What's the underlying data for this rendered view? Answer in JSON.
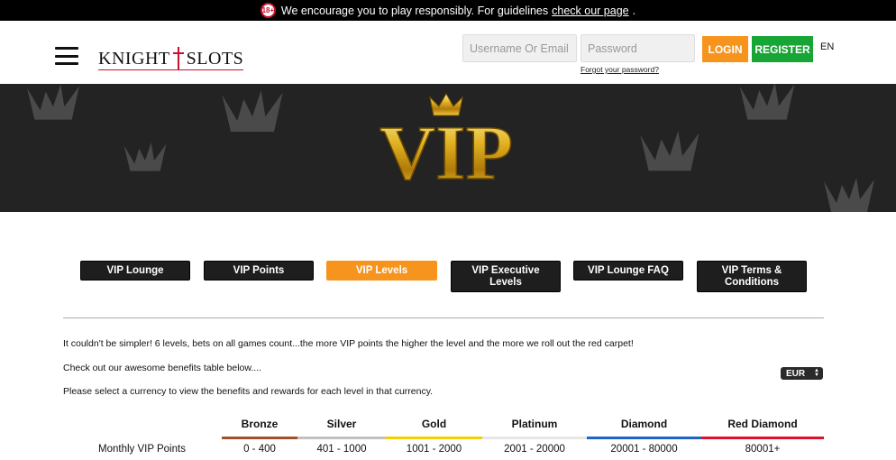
{
  "banner": {
    "badge": "18+",
    "text": "We encourage you to play responsibly. For guidelines",
    "link": "check our page",
    "suffix": "."
  },
  "header": {
    "logo_left": "KNIGHT",
    "logo_right": "SLOTS",
    "username_placeholder": "Username Or Email",
    "password_placeholder": "Password",
    "forgot": "Forgot your password?",
    "login": "LOGIN",
    "register": "REGISTER",
    "language": "EN"
  },
  "hero": {
    "title": "VIP"
  },
  "tabs": [
    {
      "label": "VIP Lounge"
    },
    {
      "label": "VIP Points"
    },
    {
      "label": "VIP Levels"
    },
    {
      "label": "VIP Executive Levels"
    },
    {
      "label": "VIP Lounge FAQ"
    },
    {
      "label": "VIP Terms & Conditions"
    }
  ],
  "content": {
    "intro": "It couldn't be simpler! 6 levels, bets on all games count...the more VIP points the higher the level and the more we roll out the red carpet!",
    "check": "Check out our awesome benefits table below....",
    "select": "Please select a currency to view the benefits and rewards for each level in that currency.",
    "currency": "EUR"
  },
  "table": {
    "columns": [
      {
        "name": "Bronze",
        "color": "#a0522d"
      },
      {
        "name": "Silver",
        "color": "#c0c0c0"
      },
      {
        "name": "Gold",
        "color": "#f5d000"
      },
      {
        "name": "Platinum",
        "color": "#e6e6e6"
      },
      {
        "name": "Diamond",
        "color": "#1e63c8"
      },
      {
        "name": "Red Diamond",
        "color": "#e0102a"
      }
    ],
    "rows": [
      {
        "label": "Monthly VIP Points",
        "values": [
          "0 - 400",
          "401 - 1000",
          "1001 - 2000",
          "2001 - 20000",
          "20001 - 80000",
          "80001+"
        ]
      }
    ]
  },
  "colors": {
    "accent": "#f7941d",
    "register": "#17a535",
    "brand_red": "#c8102e"
  }
}
